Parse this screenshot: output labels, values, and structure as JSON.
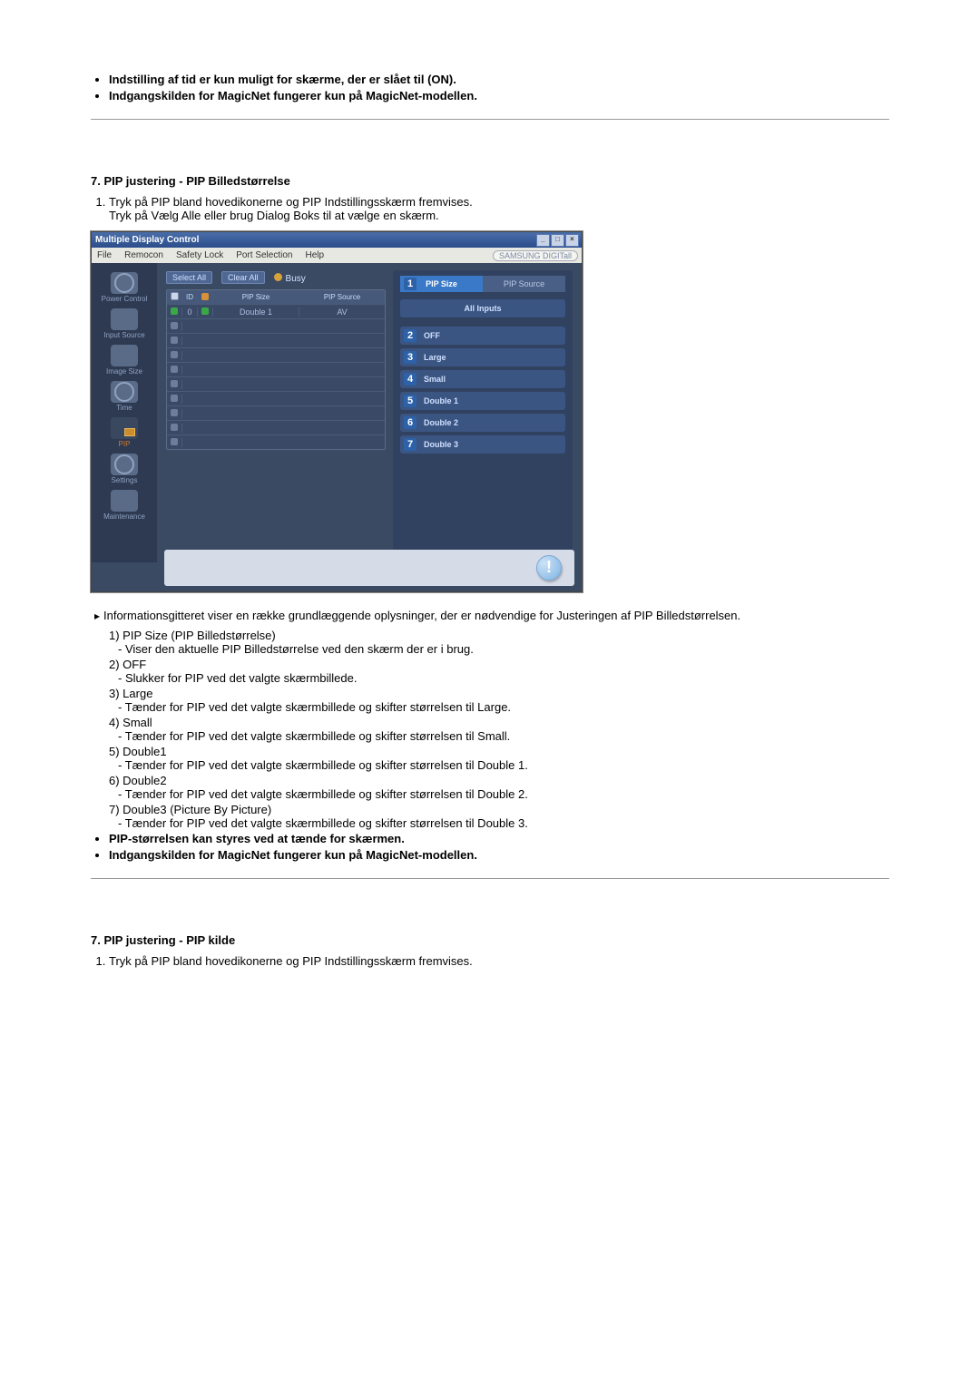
{
  "topBullets": [
    "Indstilling af tid er kun muligt for skærme, der er slået til (ON).",
    "Indgangskilden for MagicNet fungerer kun på MagicNet-modellen."
  ],
  "section1": {
    "heading": "7. PIP justering - PIP Billedstørrelse",
    "steps": [
      "Tryk på PIP bland hovedikonerne og PIP Indstillingsskærm fremvises.\nTryk på Vælg Alle eller brug Dialog Boks til at vælge en skærm."
    ],
    "infoNote": "Informationsgitteret viser en række grundlæggende oplysninger, der er nødvendige for Justeringen af PIP Billedstørrelsen.",
    "defs": [
      {
        "num": "1)",
        "title": "PIP Size (PIP Billedstørrelse)",
        "desc": "- Viser den aktuelle PIP Billedstørrelse ved den skærm der er i brug."
      },
      {
        "num": "2)",
        "title": "OFF",
        "desc": "- Slukker for PIP ved det valgte skærmbillede."
      },
      {
        "num": "3)",
        "title": "Large",
        "desc": "- Tænder for PIP ved det valgte skærmbillede og skifter størrelsen til Large."
      },
      {
        "num": "4)",
        "title": "Small",
        "desc": "- Tænder for PIP ved det valgte skærmbillede og skifter størrelsen til Small."
      },
      {
        "num": "5)",
        "title": "Double1",
        "desc": "- Tænder for PIP ved det valgte skærmbillede og skifter størrelsen til Double 1."
      },
      {
        "num": "6)",
        "title": "Double2",
        "desc": "- Tænder for PIP ved det valgte skærmbillede og skifter størrelsen til Double 2."
      },
      {
        "num": "7)",
        "title": "Double3 (Picture By Picture)",
        "desc": "- Tænder for PIP ved det valgte skærmbillede og skifter størrelsen til Double 3."
      }
    ],
    "bottomBullets": [
      "PIP-størrelsen kan styres ved at tænde for skærmen.",
      "Indgangskilden for MagicNet fungerer kun på MagicNet-modellen."
    ]
  },
  "section2": {
    "heading": "7. PIP justering - PIP kilde",
    "steps": [
      "Tryk på PIP bland hovedikonerne og PIP Indstillingsskærm fremvises."
    ]
  },
  "app": {
    "title": "Multiple Display Control",
    "menu": [
      "File",
      "Remocon",
      "Safety Lock",
      "Port Selection",
      "Help"
    ],
    "brand": "SAMSUNG DIGITall",
    "sideItems": [
      "Power Control",
      "Input Source",
      "Image Size",
      "Time",
      "PIP",
      "Settings",
      "Maintenance"
    ],
    "toolbar": {
      "select": "Select All",
      "clear": "Clear All",
      "busy": "Busy"
    },
    "gridHead": {
      "id": "ID",
      "pipSize": "PIP Size",
      "pipSource": "PIP Source"
    },
    "gridRow1": {
      "id": "0",
      "pipSize": "Double 1",
      "pipSource": "AV"
    },
    "tabs": {
      "active": "PIP Size",
      "activeNum": "1",
      "inactive": "PIP Source"
    },
    "allInputs": "All Inputs",
    "opts": [
      {
        "n": "2",
        "t": "OFF"
      },
      {
        "n": "3",
        "t": "Large"
      },
      {
        "n": "4",
        "t": "Small"
      },
      {
        "n": "5",
        "t": "Double 1"
      },
      {
        "n": "6",
        "t": "Double 2"
      },
      {
        "n": "7",
        "t": "Double 3"
      }
    ]
  }
}
